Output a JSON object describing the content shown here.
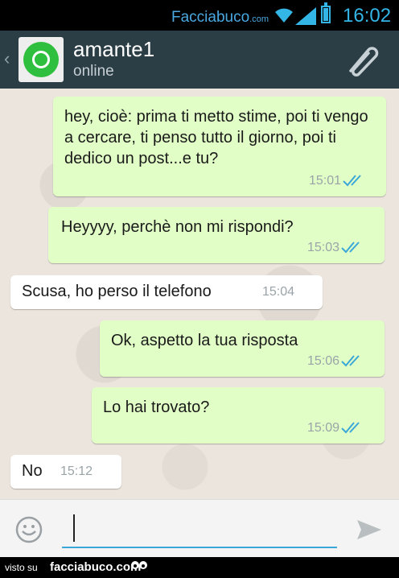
{
  "status_bar": {
    "brand_main": "Facciabuco",
    "brand_suffix": ".com",
    "time": "16:02",
    "icons": [
      "wifi-icon",
      "signal-icon",
      "battery-icon"
    ]
  },
  "header": {
    "contact_name": "amante1",
    "status": "online",
    "avatar_icon": "whatsapp-logo",
    "attach_icon": "paperclip-icon"
  },
  "messages": [
    {
      "direction": "out",
      "text": "hey, cioè: prima ti metto stime, poi ti vengo a cercare, ti penso tutto il giorno, poi ti dedico un post...e tu?",
      "time": "15:01",
      "read": true
    },
    {
      "direction": "out",
      "text": "Heyyyy, perchè non mi rispondi?",
      "time": "15:03",
      "read": true
    },
    {
      "direction": "in",
      "text": "Scusa, ho perso il telefono",
      "time": "15:04"
    },
    {
      "direction": "out",
      "text": "Ok, aspetto la tua risposta",
      "time": "15:06",
      "read": true
    },
    {
      "direction": "out",
      "text": "Lo hai trovato?",
      "time": "15:09",
      "read": true
    },
    {
      "direction": "in",
      "text": "No",
      "time": "15:12"
    }
  ],
  "composer": {
    "value": "",
    "emoji_icon": "smiley-icon",
    "send_icon": "send-icon"
  },
  "footer": {
    "prefix": "visto su",
    "site": "facciabuco.com"
  },
  "colors": {
    "header_bg": "#2b3d45",
    "outgoing_bubble": "#e1fec6",
    "incoming_bubble": "#ffffff",
    "chat_bg": "#ece5dd",
    "read_ticks": "#3ba7d8",
    "accent": "#33b5e5"
  }
}
